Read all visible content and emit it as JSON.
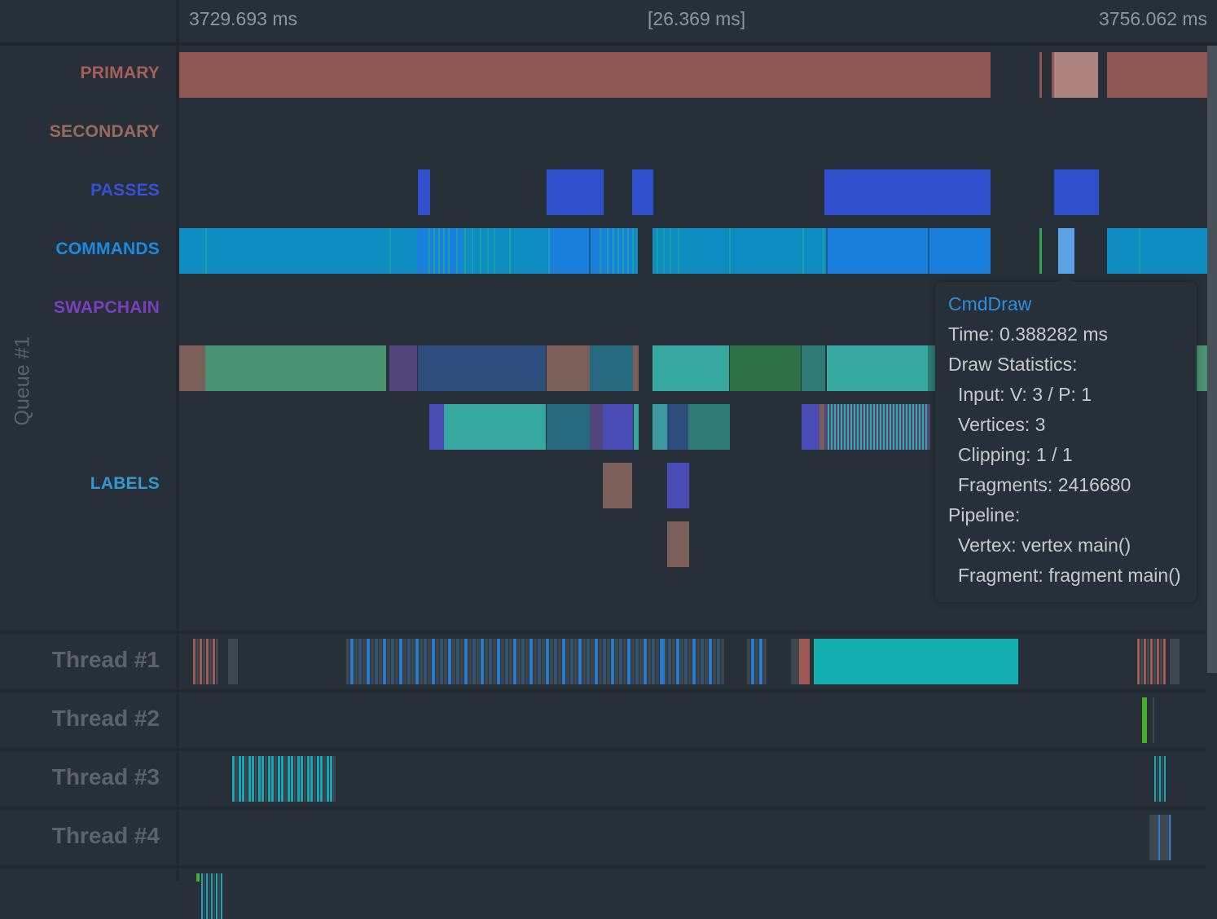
{
  "timeline": {
    "start_time": "3729.693 ms",
    "span": "[26.369 ms]",
    "end_time": "3756.062 ms"
  },
  "queue": {
    "label": "Queue #1",
    "tracks": [
      {
        "id": "primary",
        "label": "PRIMARY",
        "color": "#8e5753"
      },
      {
        "id": "secondary",
        "label": "SECONDARY",
        "color": "#9a6a5c"
      },
      {
        "id": "passes",
        "label": "PASSES",
        "color": "#3350d0"
      },
      {
        "id": "commands",
        "label": "COMMANDS",
        "color": "#1a8ae0"
      },
      {
        "id": "swapchain",
        "label": "SWAPCHAIN",
        "color": "#7a3ec0"
      },
      {
        "id": "labels",
        "label": "LABELS",
        "color": "#3399cc"
      }
    ]
  },
  "threads": [
    {
      "label": "Thread #1"
    },
    {
      "label": "Thread #2"
    },
    {
      "label": "Thread #3"
    },
    {
      "label": "Thread #4"
    }
  ],
  "tooltip": {
    "title": "CmdDraw",
    "time": "Time: 0.388282 ms",
    "draw_stats_header": "Draw Statistics:",
    "input": "Input: V: 3 / P: 1",
    "vertices": "Vertices: 3",
    "clipping": "Clipping: 1 / 1",
    "fragments": "Fragments: 2416680",
    "pipeline_header": "Pipeline:",
    "vertex": "Vertex: vertex main()",
    "fragment": "Fragment: fragment main()"
  },
  "colors": {
    "primary": "#8e5753",
    "primary_selected": "#ad8380",
    "pass": "#2f4fcc",
    "cmd": "#0f8cc2",
    "cmd_bright": "#1b7fde",
    "cmd_stripe": "#17a2a8",
    "cmd_selected": "#5aa2e4",
    "green": "#4a9372",
    "dkgreen": "#2e7045",
    "brown": "#7a6058",
    "purple": "#52457a",
    "navy": "#2d4e7c",
    "petrol": "#276a80",
    "teal": "#36a89f",
    "dteal": "#2e7a74",
    "violet": "#4a4bb5",
    "cyan_big": "#15aeb0",
    "thread_gray": "#3e474e",
    "thread_blue": "#2a7ad0",
    "thread_red": "#a05a55",
    "thread_cyan": "#16a6b8",
    "thread_green": "#45b02a"
  }
}
